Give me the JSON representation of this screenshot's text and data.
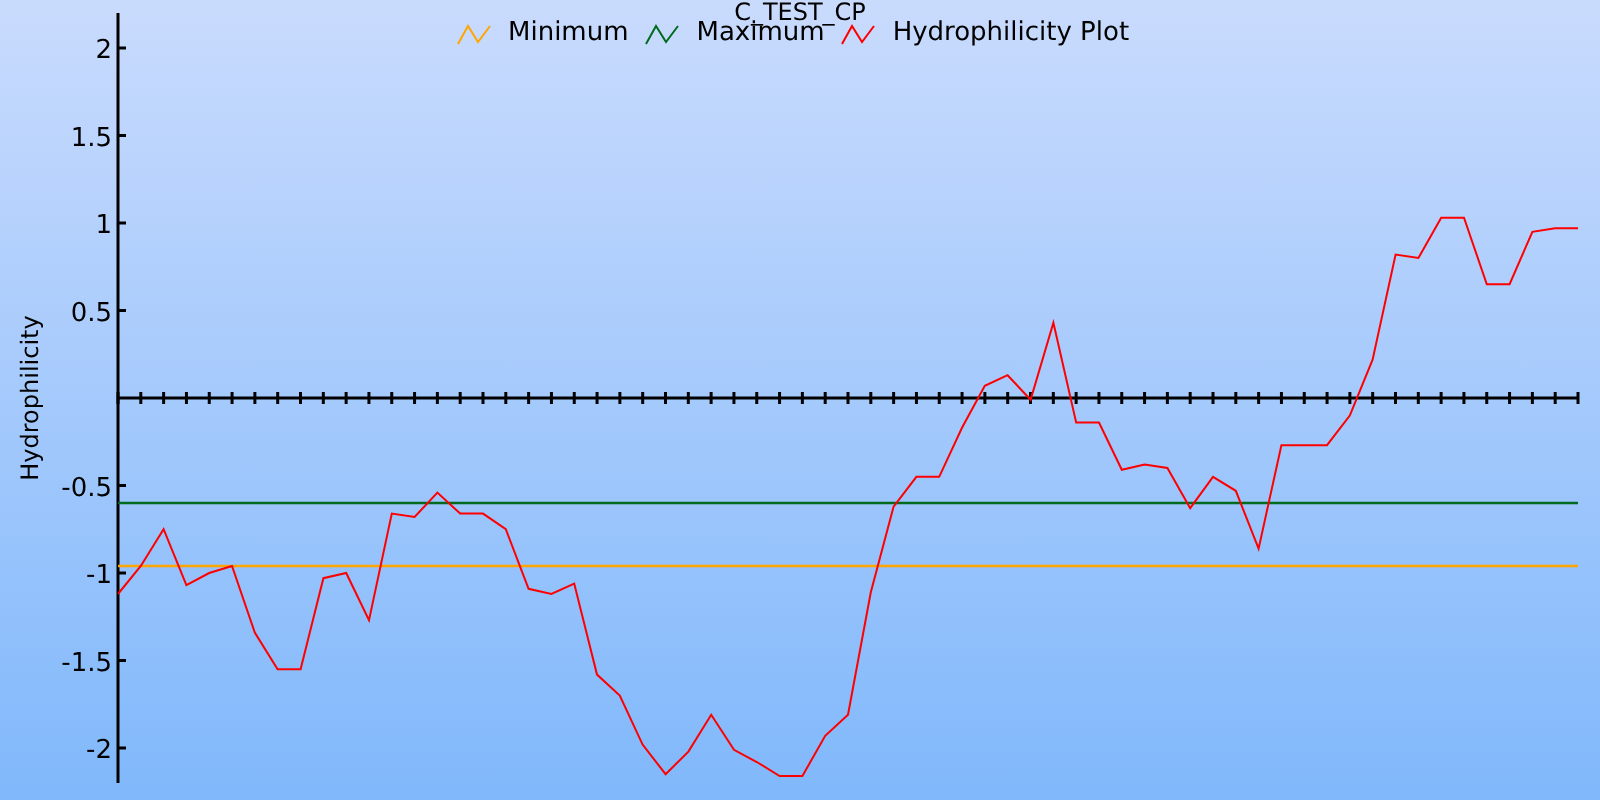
{
  "chart_data": {
    "type": "line",
    "title": "C_TEST_CP",
    "ylabel": "Hydrophilicity",
    "ylim": [
      -2.2,
      2.2
    ],
    "yticks": [
      -2,
      -1.5,
      -1,
      -0.5,
      0.5,
      1,
      1.5,
      2
    ],
    "series": [
      {
        "name": "Minimum",
        "color": "#ffa500",
        "values": [
          -0.96,
          -0.96,
          -0.96,
          -0.96,
          -0.96,
          -0.96,
          -0.96,
          -0.96,
          -0.96,
          -0.96,
          -0.96,
          -0.96,
          -0.96,
          -0.96,
          -0.96,
          -0.96,
          -0.96,
          -0.96,
          -0.96,
          -0.96,
          -0.96,
          -0.96,
          -0.96,
          -0.96,
          -0.96,
          -0.96,
          -0.96,
          -0.96,
          -0.96,
          -0.96,
          -0.96,
          -0.96,
          -0.96,
          -0.96,
          -0.96,
          -0.96,
          -0.96,
          -0.96,
          -0.96,
          -0.96,
          -0.96,
          -0.96,
          -0.96,
          -0.96,
          -0.96,
          -0.96,
          -0.96,
          -0.96,
          -0.96,
          -0.96,
          -0.96,
          -0.96,
          -0.96,
          -0.96,
          -0.96,
          -0.96,
          -0.96,
          -0.96,
          -0.96,
          -0.96,
          -0.96,
          -0.96,
          -0.96,
          -0.96,
          -0.96
        ]
      },
      {
        "name": "Maximum",
        "color": "#006a1e",
        "values": [
          -0.6,
          -0.6,
          -0.6,
          -0.6,
          -0.6,
          -0.6,
          -0.6,
          -0.6,
          -0.6,
          -0.6,
          -0.6,
          -0.6,
          -0.6,
          -0.6,
          -0.6,
          -0.6,
          -0.6,
          -0.6,
          -0.6,
          -0.6,
          -0.6,
          -0.6,
          -0.6,
          -0.6,
          -0.6,
          -0.6,
          -0.6,
          -0.6,
          -0.6,
          -0.6,
          -0.6,
          -0.6,
          -0.6,
          -0.6,
          -0.6,
          -0.6,
          -0.6,
          -0.6,
          -0.6,
          -0.6,
          -0.6,
          -0.6,
          -0.6,
          -0.6,
          -0.6,
          -0.6,
          -0.6,
          -0.6,
          -0.6,
          -0.6,
          -0.6,
          -0.6,
          -0.6,
          -0.6,
          -0.6,
          -0.6,
          -0.6,
          -0.6,
          -0.6,
          -0.6,
          -0.6,
          -0.6,
          -0.6,
          -0.6,
          -0.6
        ]
      },
      {
        "name": "Hydrophilicity Plot",
        "color": "#ff0000",
        "values": [
          -1.12,
          -0.96,
          -0.75,
          -1.07,
          -1.0,
          -0.96,
          -1.34,
          -1.55,
          -1.55,
          -1.03,
          -1.0,
          -1.27,
          -0.66,
          -0.68,
          -0.54,
          -0.66,
          -0.66,
          -0.75,
          -1.09,
          -1.12,
          -1.06,
          -1.58,
          -1.7,
          -1.98,
          -2.15,
          -2.02,
          -1.81,
          -2.01,
          -2.08,
          -2.16,
          -2.16,
          -1.93,
          -1.81,
          -1.11,
          -0.62,
          -0.45,
          -0.45,
          -0.17,
          0.07,
          0.13,
          -0.01,
          0.43,
          -0.14,
          -0.14,
          -0.41,
          -0.38,
          -0.4,
          -0.63,
          -0.45,
          -0.53,
          -0.86,
          -0.27,
          -0.27,
          -0.27,
          -0.1,
          0.22,
          0.82,
          0.8,
          1.03,
          1.03,
          0.65,
          0.65,
          0.95,
          0.97,
          0.97
        ]
      }
    ]
  }
}
